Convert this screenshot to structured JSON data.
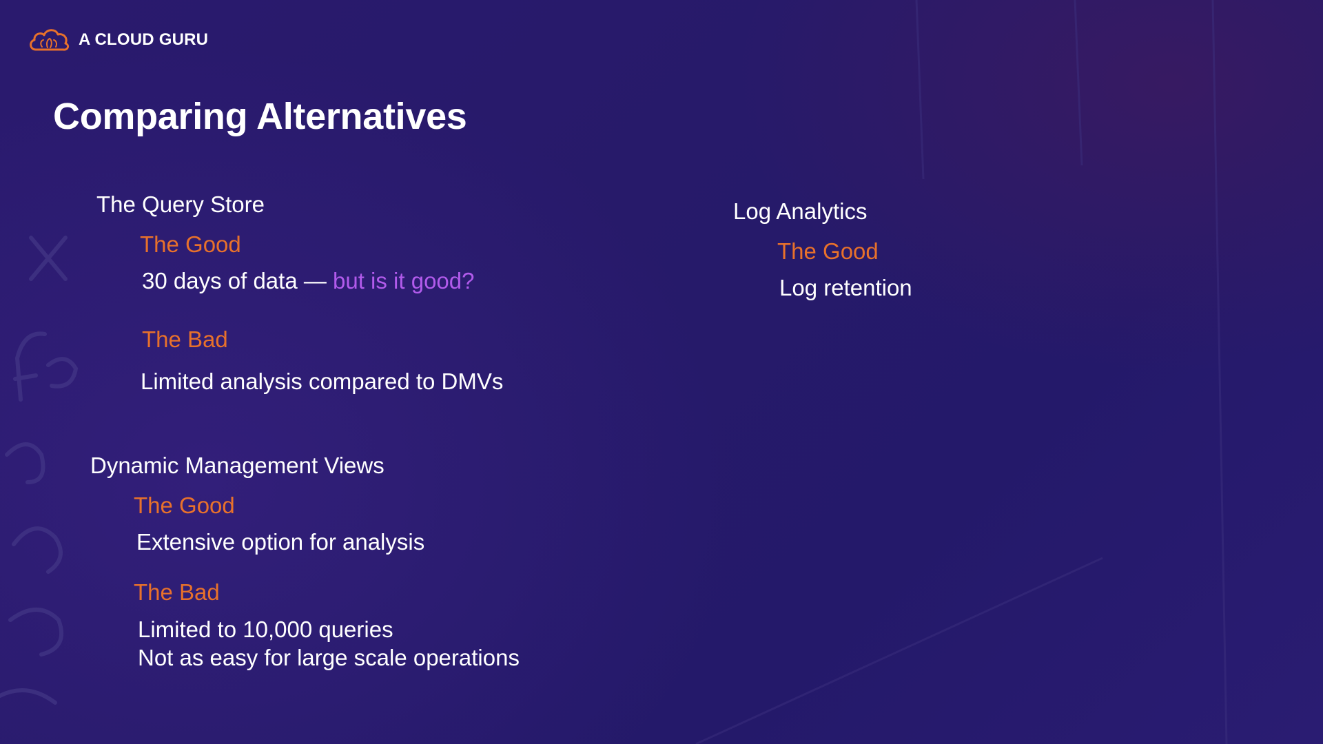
{
  "brand": {
    "name": "A CLOUD GURU",
    "accent_color": "#e8712b",
    "highlight_color": "#b25bec",
    "logo_icon": "cloud-icon"
  },
  "slide": {
    "title": "Comparing Alternatives"
  },
  "query_store": {
    "heading": "The Query Store",
    "good_label": "The Good",
    "good_text_main": "30 days of data — ",
    "good_text_highlight": "but is it good?",
    "bad_label": "The Bad",
    "bad_text": "Limited analysis compared to DMVs"
  },
  "dmv": {
    "heading": "Dynamic Management Views",
    "good_label": "The Good",
    "good_text": "Extensive option for analysis",
    "bad_label": "The Bad",
    "bad_lines": [
      "Limited to 10,000 queries",
      "Not as easy for large scale operations"
    ]
  },
  "log_analytics": {
    "heading": "Log Analytics",
    "good_label": "The Good",
    "good_text": "Log retention"
  }
}
